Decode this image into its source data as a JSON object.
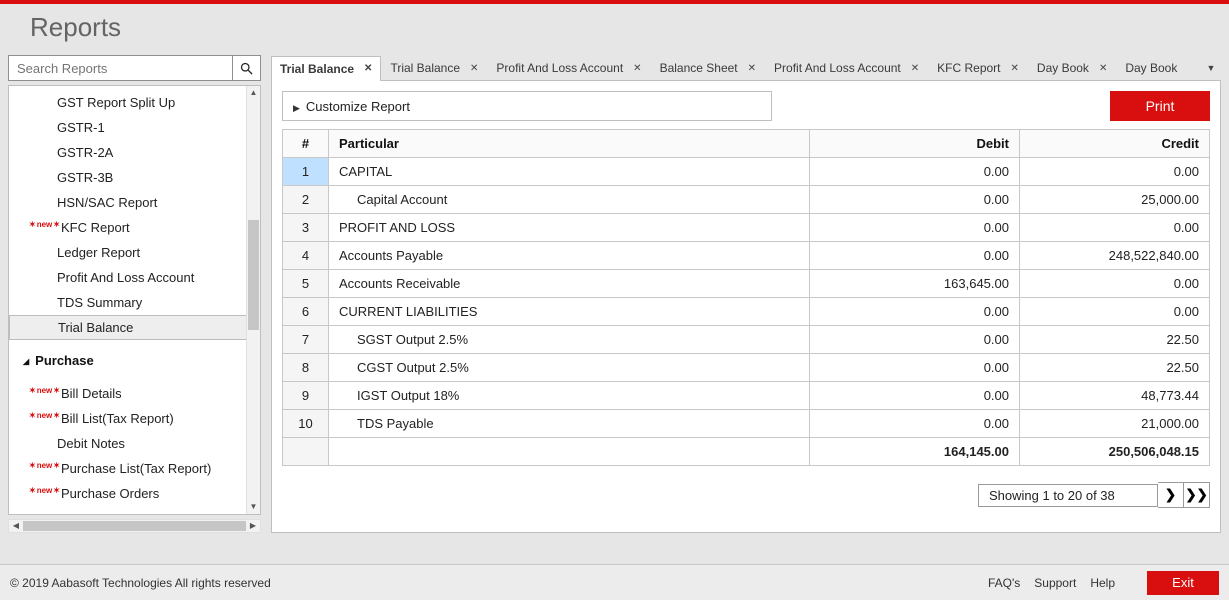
{
  "page": {
    "title": "Reports"
  },
  "search": {
    "placeholder": "Search Reports"
  },
  "sidebar": {
    "items": [
      {
        "label": "GST Report Split Up",
        "new": false
      },
      {
        "label": "GSTR-1",
        "new": false
      },
      {
        "label": "GSTR-2A",
        "new": false
      },
      {
        "label": "GSTR-3B",
        "new": false
      },
      {
        "label": "HSN/SAC Report",
        "new": false
      },
      {
        "label": "KFC Report",
        "new": true
      },
      {
        "label": "Ledger Report",
        "new": false
      },
      {
        "label": "Profit And Loss Account",
        "new": false
      },
      {
        "label": "TDS Summary",
        "new": false
      },
      {
        "label": "Trial Balance",
        "new": false,
        "active": true
      }
    ],
    "group": {
      "label": "Purchase"
    },
    "subitems": [
      {
        "label": "Bill Details",
        "new": true
      },
      {
        "label": "Bill List(Tax Report)",
        "new": true
      },
      {
        "label": "Debit Notes",
        "new": false
      },
      {
        "label": "Purchase List(Tax Report)",
        "new": true
      },
      {
        "label": "Purchase Orders",
        "new": true
      }
    ],
    "new_badge": "new"
  },
  "tabs": {
    "items": [
      {
        "label": "Trial Balance",
        "active": true
      },
      {
        "label": "Trial Balance"
      },
      {
        "label": "Profit And Loss Account"
      },
      {
        "label": "Balance Sheet"
      },
      {
        "label": "Profit And Loss Account"
      },
      {
        "label": "KFC Report"
      },
      {
        "label": "Day Book"
      },
      {
        "label": "Day Book",
        "noclose": true
      }
    ]
  },
  "toolbar": {
    "customize": "Customize Report",
    "print": "Print"
  },
  "grid": {
    "headers": {
      "idx": "#",
      "particular": "Particular",
      "debit": "Debit",
      "credit": "Credit"
    },
    "rows": [
      {
        "idx": "1",
        "particular": "CAPITAL",
        "debit": "0.00",
        "credit": "0.00",
        "indent": 0
      },
      {
        "idx": "2",
        "particular": "Capital Account",
        "debit": "0.00",
        "credit": "25,000.00",
        "indent": 1
      },
      {
        "idx": "3",
        "particular": "PROFIT AND LOSS",
        "debit": "0.00",
        "credit": "0.00",
        "indent": 0
      },
      {
        "idx": "4",
        "particular": "Accounts Payable",
        "debit": "0.00",
        "credit": "248,522,840.00",
        "indent": 0
      },
      {
        "idx": "5",
        "particular": "Accounts Receivable",
        "debit": "163,645.00",
        "credit": "0.00",
        "indent": 0
      },
      {
        "idx": "6",
        "particular": "CURRENT LIABILITIES",
        "debit": "0.00",
        "credit": "0.00",
        "indent": 0
      },
      {
        "idx": "7",
        "particular": "SGST Output 2.5%",
        "debit": "0.00",
        "credit": "22.50",
        "indent": 1
      },
      {
        "idx": "8",
        "particular": "CGST Output 2.5%",
        "debit": "0.00",
        "credit": "22.50",
        "indent": 1
      },
      {
        "idx": "9",
        "particular": "IGST Output 18%",
        "debit": "0.00",
        "credit": "48,773.44",
        "indent": 1
      },
      {
        "idx": "10",
        "particular": "TDS Payable",
        "debit": "0.00",
        "credit": "21,000.00",
        "indent": 1
      }
    ],
    "totals": {
      "debit": "164,145.00",
      "credit": "250,506,048.15"
    }
  },
  "pager": {
    "status": "Showing 1 to 20 of 38",
    "next": "❯",
    "last": "❯❯"
  },
  "footer": {
    "copyright": "© 2019 Aabasoft Technologies All rights reserved",
    "links": {
      "faqs": "FAQ's",
      "support": "Support",
      "help": "Help"
    },
    "exit": "Exit"
  }
}
